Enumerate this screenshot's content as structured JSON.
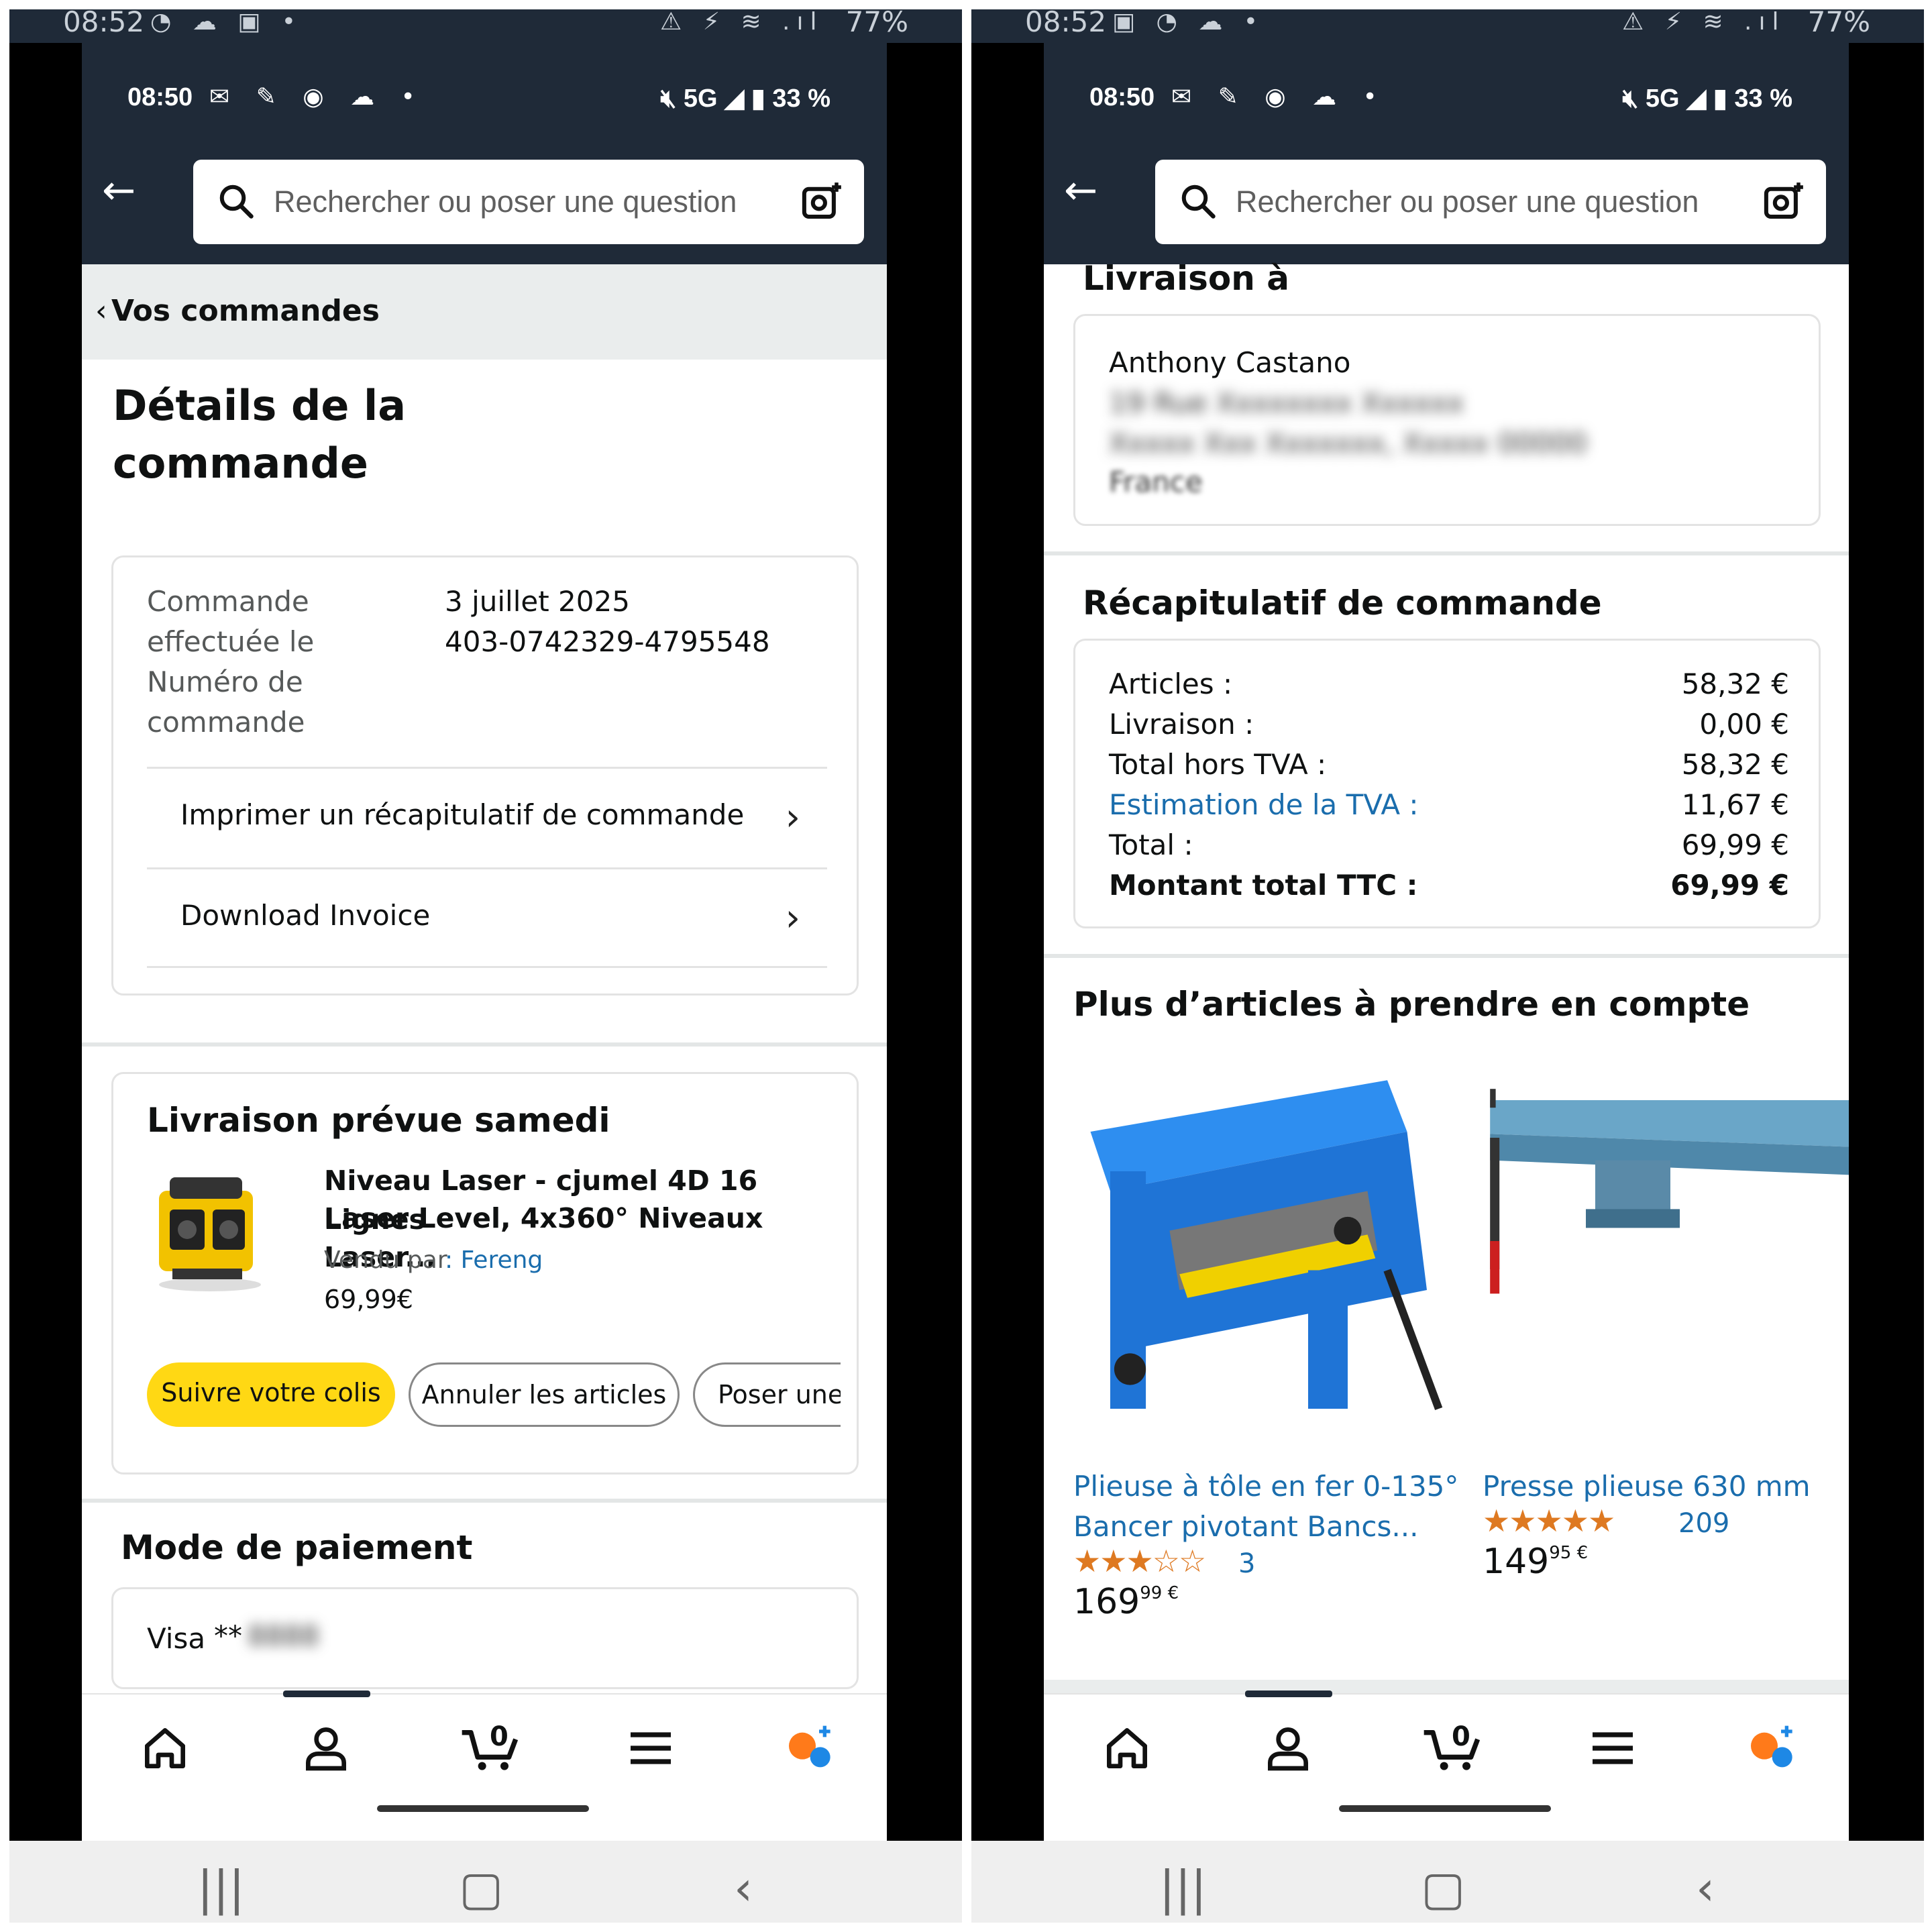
{
  "outer_status": {
    "time": "08:52",
    "battery": "77%"
  },
  "phone_status": {
    "time": "08:50",
    "network": "5G",
    "battery": "33 %"
  },
  "search": {
    "placeholder": "Rechercher ou poser une question"
  },
  "left": {
    "breadcrumb": "Vos commandes",
    "title": "Détails de la commande",
    "order": {
      "placed_label": "Commande effectuée le",
      "placed_value": "3 juillet 2025",
      "number_label": "Numéro de commande",
      "number_value": "403-0742329-4795548"
    },
    "links": {
      "print": "Imprimer un récapitulatif de commande",
      "invoice": "Download Invoice"
    },
    "delivery": {
      "heading": "Livraison prévue samedi",
      "product_line1": "Niveau Laser - cjumel 4D 16 Lignes",
      "product_line2": "Laser Level, 4x360° Niveaux Laser...",
      "sold_by_label": "Vendu par",
      "seller": ": Fereng",
      "price": "69,99€",
      "buttons": {
        "track": "Suivre votre colis",
        "cancel": "Annuler les articles",
        "ask": "Poser une"
      }
    },
    "payment": {
      "heading": "Mode de paiement",
      "card": "Visa",
      "masked": "**"
    }
  },
  "right": {
    "shipping": {
      "heading": "Livraison à",
      "name": "Anthony Castano",
      "country": "France"
    },
    "summary": {
      "heading": "Récapitulatif de commande",
      "rows": [
        {
          "label": "Articles :",
          "value": "58,32 €"
        },
        {
          "label": "Livraison :",
          "value": "0,00 €"
        },
        {
          "label": "Total hors TVA :",
          "value": "58,32 €"
        },
        {
          "label": "Estimation de la TVA :",
          "value": "11,67 €"
        },
        {
          "label": "Total :",
          "value": "69,99 €"
        },
        {
          "label": "Montant total TTC :",
          "value": "69,99 €"
        }
      ]
    },
    "more": {
      "heading": "Plus d’articles à prendre en compte",
      "products": [
        {
          "title_line1": "Plieuse à tôle en fer 0-135°",
          "title_line2": "Bancer pivotant Bancs...",
          "stars": "★★★☆☆",
          "rating": 3,
          "reviews": "3",
          "price_main": "169",
          "price_cents": "99 €"
        },
        {
          "title_line1": "Presse plieuse 630 mm",
          "stars": "★★★★★",
          "rating": 4.5,
          "reviews": "209",
          "price_main": "149",
          "price_cents": "95 €"
        }
      ]
    }
  },
  "bottom_nav": {
    "cart_count": "0"
  },
  "colors": {
    "header": "#1f2a38",
    "accent_yellow": "#ffd814",
    "link_blue": "#1a6dad",
    "star_orange": "#de7921"
  },
  "icons": [
    "back-arrow-icon",
    "search-icon",
    "camera-icon",
    "home-icon",
    "account-icon",
    "cart-icon",
    "menu-icon",
    "rufus-icon",
    "chevron-right-icon"
  ]
}
